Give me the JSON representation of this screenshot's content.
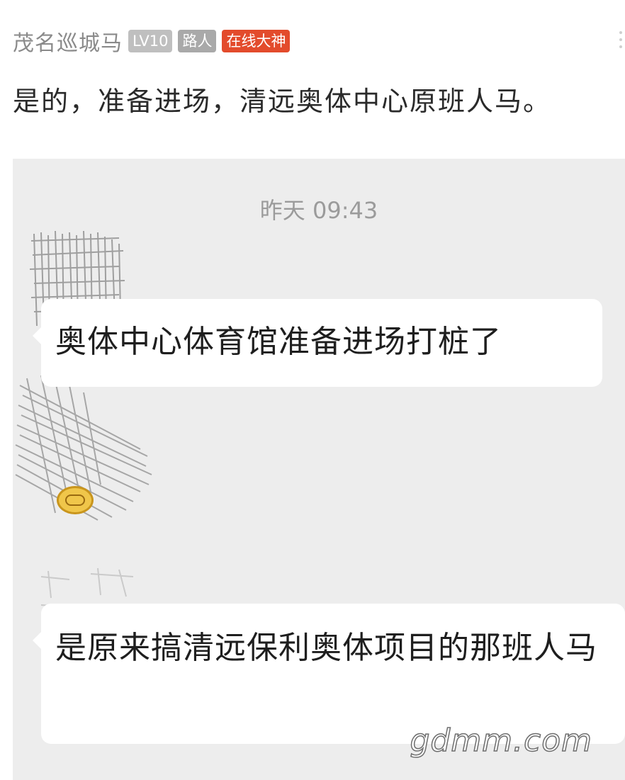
{
  "post": {
    "username": "茂名巡城马",
    "badges": {
      "level": "LV10",
      "role": "路人",
      "title": "在线大神"
    },
    "content": "是的，准备进场，清远奥体中心原班人马。"
  },
  "chat": {
    "timestamp": "昨天 09:43",
    "messages": [
      {
        "text": "奥体中心体育馆准备进场打桩了"
      },
      {
        "text": "是原来搞清远保利奥体项目的那班人马"
      }
    ]
  },
  "watermark": "gdmm.com",
  "colors": {
    "god_badge": "#e34b2c",
    "level_badge": "#bfbfbf",
    "role_badge": "#a9a9a9",
    "chat_background": "#ededed",
    "bubble": "#ffffff"
  }
}
